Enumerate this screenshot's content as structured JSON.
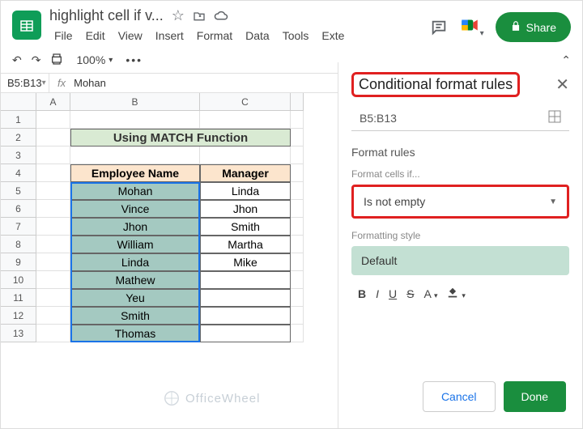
{
  "header": {
    "title": "highlight cell if v...",
    "menus": [
      "File",
      "Edit",
      "View",
      "Insert",
      "Format",
      "Data",
      "Tools",
      "Exte"
    ],
    "share": "Share"
  },
  "toolbar": {
    "zoom": "100%"
  },
  "namebox": "B5:B13",
  "fx_value": "Mohan",
  "columns": {
    "A": "A",
    "B": "B",
    "C": "C"
  },
  "table_title": "Using MATCH Function",
  "headers": {
    "b": "Employee Name",
    "c": "Manager"
  },
  "rows": [
    {
      "b": "Mohan",
      "c": "Linda"
    },
    {
      "b": "Vince",
      "c": "Jhon"
    },
    {
      "b": "Jhon",
      "c": "Smith"
    },
    {
      "b": "William",
      "c": "Martha"
    },
    {
      "b": "Linda",
      "c": "Mike"
    },
    {
      "b": "Mathew",
      "c": ""
    },
    {
      "b": "Yeu",
      "c": ""
    },
    {
      "b": "Smith",
      "c": ""
    },
    {
      "b": "Thomas",
      "c": ""
    }
  ],
  "row_nums": [
    "1",
    "2",
    "3",
    "4",
    "5",
    "6",
    "7",
    "8",
    "9",
    "10",
    "11",
    "12",
    "13"
  ],
  "sidepanel": {
    "title": "Conditional format rules",
    "range": "B5:B13",
    "section1": "Format rules",
    "label1": "Format cells if...",
    "condition": "Is not empty",
    "label2": "Formatting style",
    "style": "Default",
    "cancel": "Cancel",
    "done": "Done"
  },
  "watermark": "OfficeWheel"
}
